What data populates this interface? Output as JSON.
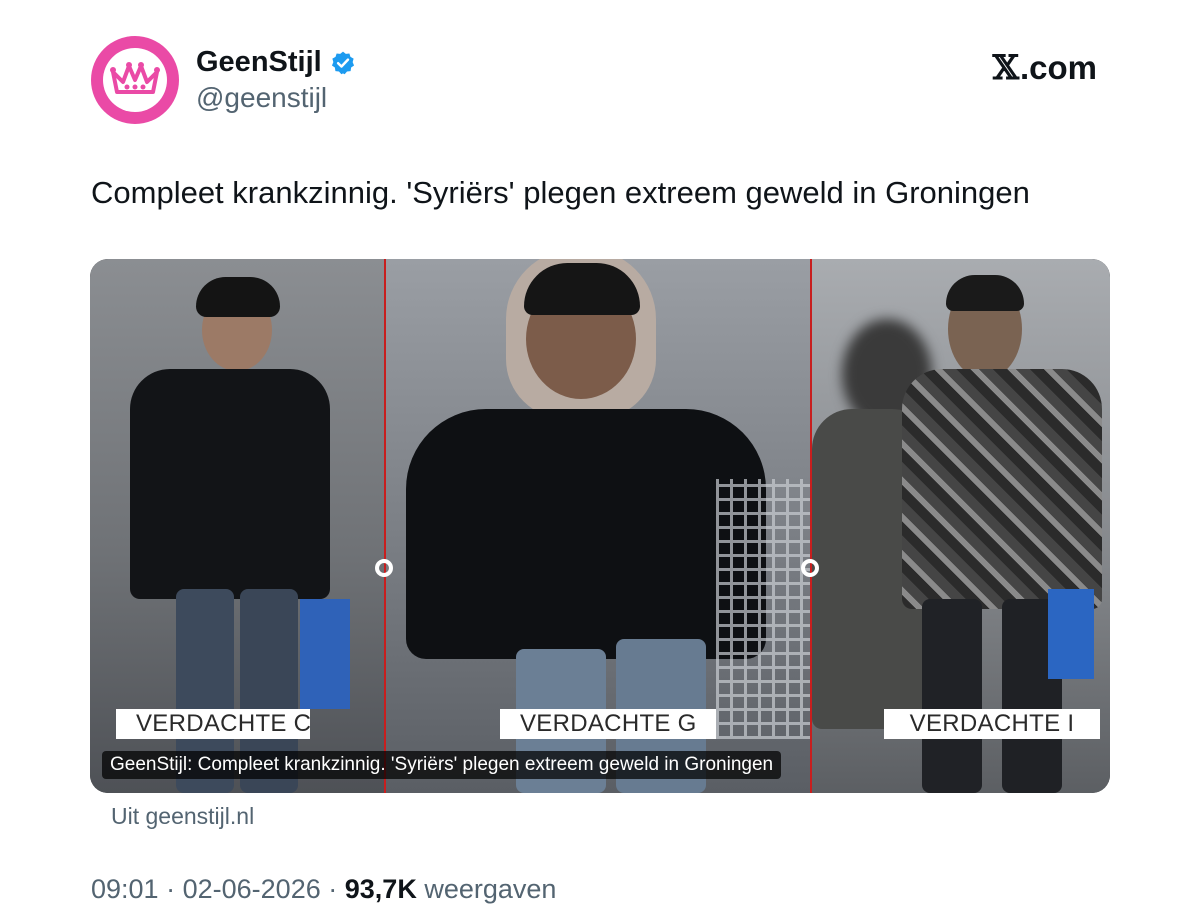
{
  "author": {
    "display_name": "GeenStijl",
    "handle": "@geenstijl",
    "avatar_icon": "crown-icon",
    "verified_icon": "verified-badge-icon",
    "brand_color": "#ea4aa6",
    "verified_color": "#1d9bf0"
  },
  "site": {
    "x_mark": "𝕏",
    "domain": ".com"
  },
  "tweet": {
    "text": "Compleet krankzinnig. 'Syriërs' plegen extreem geweld in Groningen"
  },
  "media": {
    "labels": [
      "VERDACHTE C",
      "VERDACHTE G",
      "VERDACHTE I"
    ],
    "caption": "GeenStijl: Compleet krankzinnig. 'Syriërs' plegen extreem geweld in Groningen",
    "divider_color": "#c81e1e"
  },
  "link": {
    "source": "Uit geenstijl.nl"
  },
  "footer": {
    "time": "09:01",
    "separator": "·",
    "date": "02-06-2026",
    "views_count": "93,7K",
    "views_label": "weergaven"
  }
}
